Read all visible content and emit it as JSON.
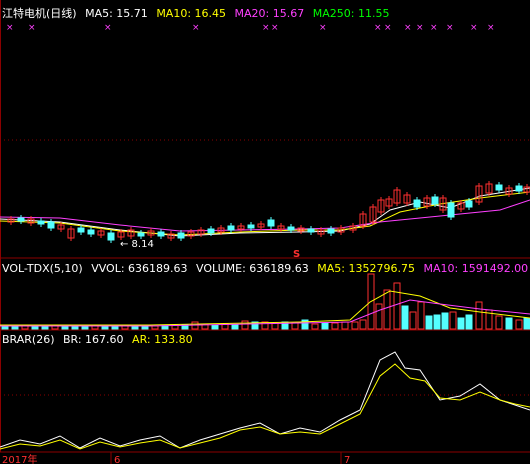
{
  "main": {
    "title": "江特电机(日线)",
    "ma5": "MA5: 15.71",
    "ma10": "MA10: 16.45",
    "ma20": "MA20: 15.67",
    "ma250": "MA250: 11.55",
    "low_marker": "← 8.14",
    "signal_mark": "S",
    "colors": {
      "up": "#ff3030",
      "down": "#54ffff",
      "ma5": "#ffffff",
      "ma10": "#ffff00",
      "ma20": "#ff40ff",
      "ma250": "#00ff00",
      "grid": "#8b0000"
    }
  },
  "volume": {
    "title": "VOL-TDX(5,10)",
    "vvol": "VVOL: 636189.63",
    "volume": "VOLUME: 636189.63",
    "ma5": "MA5: 1352796.75",
    "ma10": "MA10: 1591492.00"
  },
  "brar": {
    "title": "BRAR(26)",
    "br": "BR: 167.60",
    "ar": "AR: 133.80"
  },
  "x_axis": {
    "year_label": "2017年",
    "month_6": "6",
    "month_7": "7"
  }
}
